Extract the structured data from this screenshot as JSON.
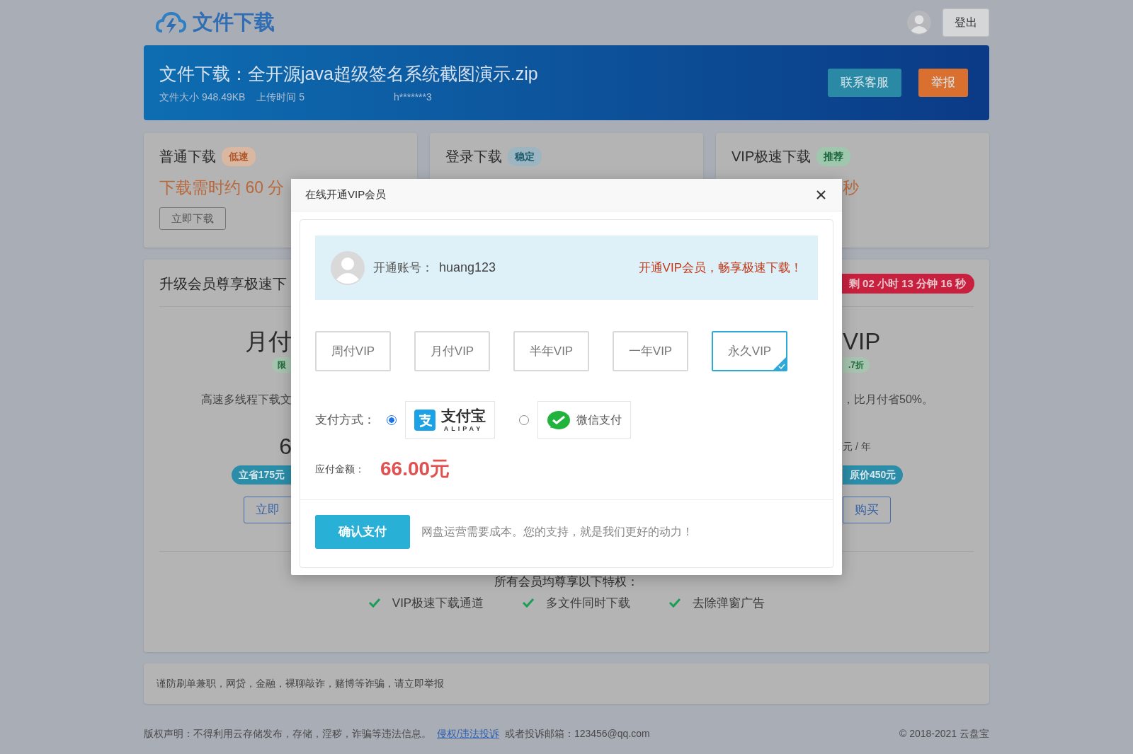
{
  "header": {
    "logo_text": "文件下载",
    "logout_button": "登出"
  },
  "banner": {
    "title": "文件下载：全开源java超级签名系统截图演示.zip",
    "meta": [
      "文件大小 948.49KB",
      "上传时间 5",
      "h*******3"
    ],
    "buttons": [
      {
        "label": "联系客服",
        "kind": "service"
      },
      {
        "label": "举报",
        "kind": "report"
      }
    ]
  },
  "download_cards": [
    {
      "title": "普通下载",
      "tag": "低速",
      "kind": "slow",
      "info": "下载需时约 60 分",
      "button": "立即下载"
    },
    {
      "title": "登录下载",
      "tag": "稳定",
      "kind": "stable"
    },
    {
      "title": "VIP极速下载",
      "tag": "推荐",
      "kind": "recommend",
      "info": "秒"
    }
  ],
  "vip_section": {
    "title": "升级会员尊享极速下",
    "countdown": "剩 02 小时 13 分钟 16 秒",
    "left_column": [
      {
        "kind": "heading",
        "text": "月付"
      },
      {
        "kind": "tag",
        "text": "限"
      },
      {
        "kind": "desc",
        "text": "高速多线程下载文"
      },
      {
        "kind": "price",
        "text": "6"
      },
      {
        "kind": "pill",
        "text": "立省175元"
      },
      {
        "kind": "button",
        "text": "立即"
      }
    ],
    "right_column": [
      {
        "kind": "heading",
        "text": "VIP"
      },
      {
        "kind": "tag",
        "text": ".7折"
      },
      {
        "kind": "desc",
        "text": "，比月付省50%。"
      },
      {
        "kind": "unit",
        "text": "元 / 年"
      },
      {
        "kind": "pill",
        "text": "原价450元"
      },
      {
        "kind": "button",
        "text": "购买"
      }
    ],
    "benefits_title": "所有会员均尊享以下特权：",
    "benefits": [
      "VIP极速下载通道",
      "多文件同时下载",
      "去除弹窗广告"
    ]
  },
  "notice": "谨防刷单兼职，网贷，金融，裸聊敲诈，赌博等诈骗，请立即举报",
  "footer": {
    "statement": "版权声明：不得利用云存储发布，存储，淫秽，诈骗等违法信息。",
    "link": "侵权/违法投诉",
    "contact": "或者投诉邮箱：123456@qq.com",
    "copyright": "© 2018-2021 云盘宝"
  },
  "modal": {
    "title": "在线开通VIP会员",
    "account_label": "开通账号：",
    "account": "huang123",
    "promo": "开通VIP会员，畅享极速下载！",
    "plans": [
      {
        "label": "周付VIP",
        "selected": false
      },
      {
        "label": "月付VIP",
        "selected": false
      },
      {
        "label": "半年VIP",
        "selected": false
      },
      {
        "label": "一年VIP",
        "selected": false
      },
      {
        "label": "永久VIP",
        "selected": true
      }
    ],
    "payment_label": "支付方式：",
    "payment_methods": [
      {
        "kind": "alipay",
        "name": "支付宝",
        "subtitle": "ALIPAY",
        "selected": true
      },
      {
        "kind": "wechat",
        "name": "微信支付",
        "selected": false
      }
    ],
    "amount_label": "应付金额：",
    "amount": "66.00元",
    "confirm_button": "确认支付",
    "note": "网盘运营需要成本。您的支持，就是我们更好的动力！"
  }
}
